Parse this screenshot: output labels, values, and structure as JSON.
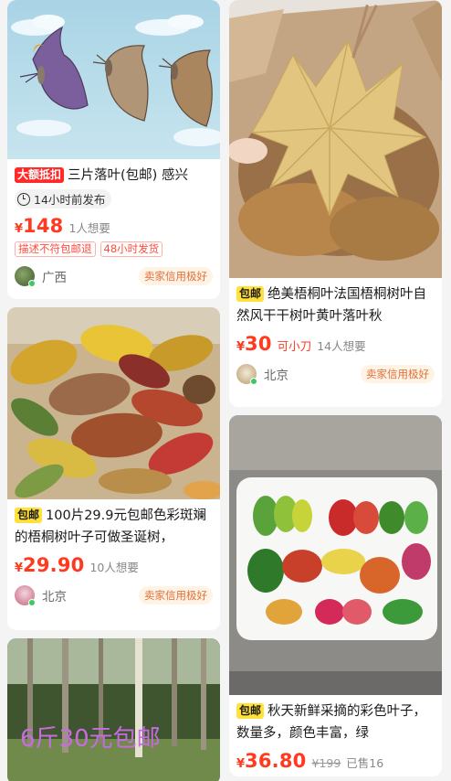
{
  "cards": [
    {
      "badge": "大额抵扣",
      "title": "三片落叶(包邮) 感兴",
      "published": "14小时前发布",
      "price_symbol": "¥",
      "price": "148",
      "want": "1人想要",
      "labels": [
        "描述不符包邮退",
        "48小时发货"
      ],
      "location": "广西",
      "credit": "卖家信用极好",
      "image_icon": "cartoon-leaf-butterflies-image"
    },
    {
      "badge": "包邮",
      "title": "绝美梧桐叶法国梧桐树叶自然风干干树叶黄叶落叶秋",
      "price_symbol": "¥",
      "price": "30",
      "bargain": "可小刀",
      "want": "14人想要",
      "location": "北京",
      "credit": "卖家信用极好",
      "image_icon": "dried-plane-tree-leaves-box-image"
    },
    {
      "badge": "包邮",
      "title": "100片29.9元包邮色彩斑斓的梧桐树叶子可做圣诞树，",
      "price_symbol": "¥",
      "price": "29.90",
      "want": "10人想要",
      "location": "北京",
      "credit": "卖家信用极好",
      "image_icon": "colorful-leaves-pile-image"
    },
    {
      "badge": "包邮",
      "title": "秋天新鲜采摘的彩色叶子，数量多，颜色丰富，绿",
      "price_symbol": "¥",
      "price": "36.80",
      "original_price": "¥199",
      "sold": "已售16",
      "image_icon": "leaves-tray-image"
    },
    {
      "overlay_text": "6斤30元包邮",
      "image_icon": "poplar-forest-image"
    }
  ]
}
